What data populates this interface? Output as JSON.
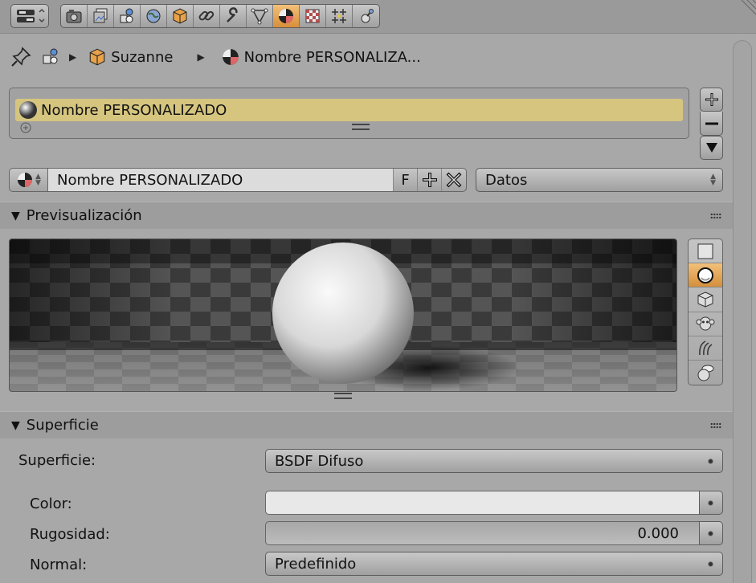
{
  "header": {
    "tabs": [
      {
        "icon": "render-camera-icon",
        "active": false
      },
      {
        "icon": "render-layers-icon",
        "active": false
      },
      {
        "icon": "scene-icon",
        "active": false
      },
      {
        "icon": "world-icon",
        "active": false
      },
      {
        "icon": "object-icon",
        "active": false
      },
      {
        "icon": "constraints-icon",
        "active": false
      },
      {
        "icon": "modifier-wrench-icon",
        "active": false
      },
      {
        "icon": "object-data-icon",
        "active": false
      },
      {
        "icon": "material-icon",
        "active": true
      },
      {
        "icon": "texture-icon",
        "active": false
      },
      {
        "icon": "particles-icon",
        "active": false
      },
      {
        "icon": "physics-icon",
        "active": false
      }
    ]
  },
  "breadcrumb": {
    "object": "Suzanne",
    "material": "Nombre PERSONALIZA..."
  },
  "slots": {
    "items": [
      "Nombre PERSONALIZADO"
    ]
  },
  "id_block": {
    "name": "Nombre PERSONALIZADO",
    "fake_user": "F",
    "link": "Datos"
  },
  "preview_panel": {
    "title": "Previsualización",
    "selected_shape": "sphere"
  },
  "surface_panel": {
    "title": "Superficie",
    "surface_label": "Superficie:",
    "surface_value": "BSDF Difuso",
    "color_label": "Color:",
    "color_value": "#e8e8e8",
    "roughness_label": "Rugosidad:",
    "roughness_value": "0.000",
    "normal_label": "Normal:",
    "normal_value": "Predefinido"
  },
  "colors": {
    "accent": "#d88f3a",
    "slot_highlight": "#d6c57f"
  }
}
